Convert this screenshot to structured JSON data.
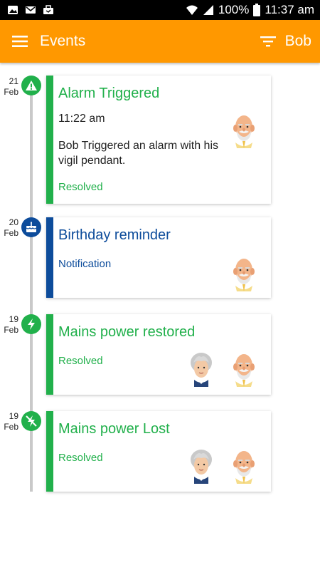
{
  "status_bar": {
    "battery": "100%",
    "time": "11:37 am"
  },
  "app_bar": {
    "title": "Events",
    "user": "Bob"
  },
  "colors": {
    "accent": "#ff9800",
    "green": "#21b04b",
    "blue": "#0d4c9b"
  },
  "events": [
    {
      "day": "21",
      "month": "Feb",
      "icon": "alarm-icon",
      "title": "Alarm Triggered",
      "time": "11:22 am",
      "description": "Bob Triggered an alarm with his vigil pendant.",
      "status": "Resolved",
      "color": "#21b04b"
    },
    {
      "day": "20",
      "month": "Feb",
      "icon": "birthday-cake-icon",
      "title": "Birthday reminder",
      "status": "Notification",
      "color": "#0d4c9b"
    },
    {
      "day": "19",
      "month": "Feb",
      "icon": "power-icon",
      "title": "Mains power restored",
      "status": "Resolved",
      "color": "#21b04b"
    },
    {
      "day": "19",
      "month": "Feb",
      "icon": "power-off-icon",
      "title": "Mains power Lost",
      "status": "Resolved",
      "color": "#21b04b"
    }
  ]
}
